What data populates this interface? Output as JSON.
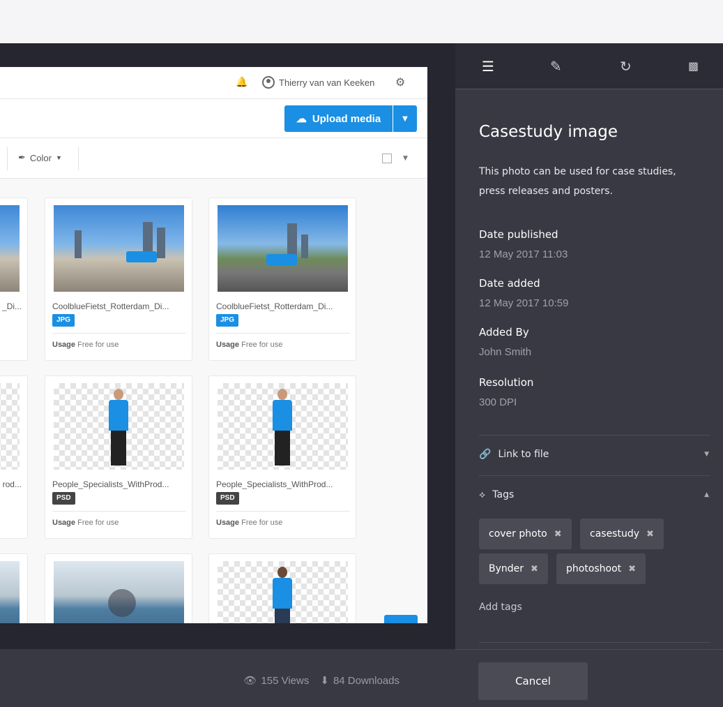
{
  "app": {
    "user_name": "Thierry van van Keeken",
    "upload_label": "Upload media",
    "color_filter_label": "Color"
  },
  "assets": [
    {
      "name": "CoolblueFietst_Rotterdam_Di...",
      "type": "JPG",
      "usage_label": "Usage",
      "usage_value": "Free for use",
      "thumb": "city"
    },
    {
      "name": "CoolblueFietst_Rotterdam_Di...",
      "type": "JPG",
      "usage_label": "Usage",
      "usage_value": "Free for use",
      "thumb": "city2"
    },
    {
      "name": "People_Specialists_WithProd...",
      "type": "PSD",
      "usage_label": "Usage",
      "usage_value": "Free for use",
      "thumb": "person"
    },
    {
      "name": "People_Specialists_WithProd...",
      "type": "PSD",
      "usage_label": "Usage",
      "usage_value": "Free for use",
      "thumb": "person"
    }
  ],
  "partial_names": {
    "left_top": "_Di...",
    "left_mid": "rod..."
  },
  "stats": {
    "views": "155 Views",
    "downloads": "84 Downloads"
  },
  "panel": {
    "title": "Casestudy image",
    "description": "This photo can be used for case studies, press releases and posters.",
    "meta": [
      {
        "label": "Date published",
        "value": "12 May  2017 11:03"
      },
      {
        "label": "Date added",
        "value": "12 May  2017 10:59"
      },
      {
        "label": "Added By",
        "value": "John Smith"
      },
      {
        "label": "Resolution",
        "value": "300 DPI"
      }
    ],
    "link_section": "Link to file",
    "tags_section": "Tags",
    "tags": [
      "cover photo",
      "casestudy",
      "Bynder",
      "photoshoot"
    ],
    "add_tags": "Add tags",
    "cancel": "Cancel"
  },
  "colors": {
    "accent": "#1a8fe3",
    "panel_bg": "#393944",
    "viewer_bg": "#252630"
  }
}
